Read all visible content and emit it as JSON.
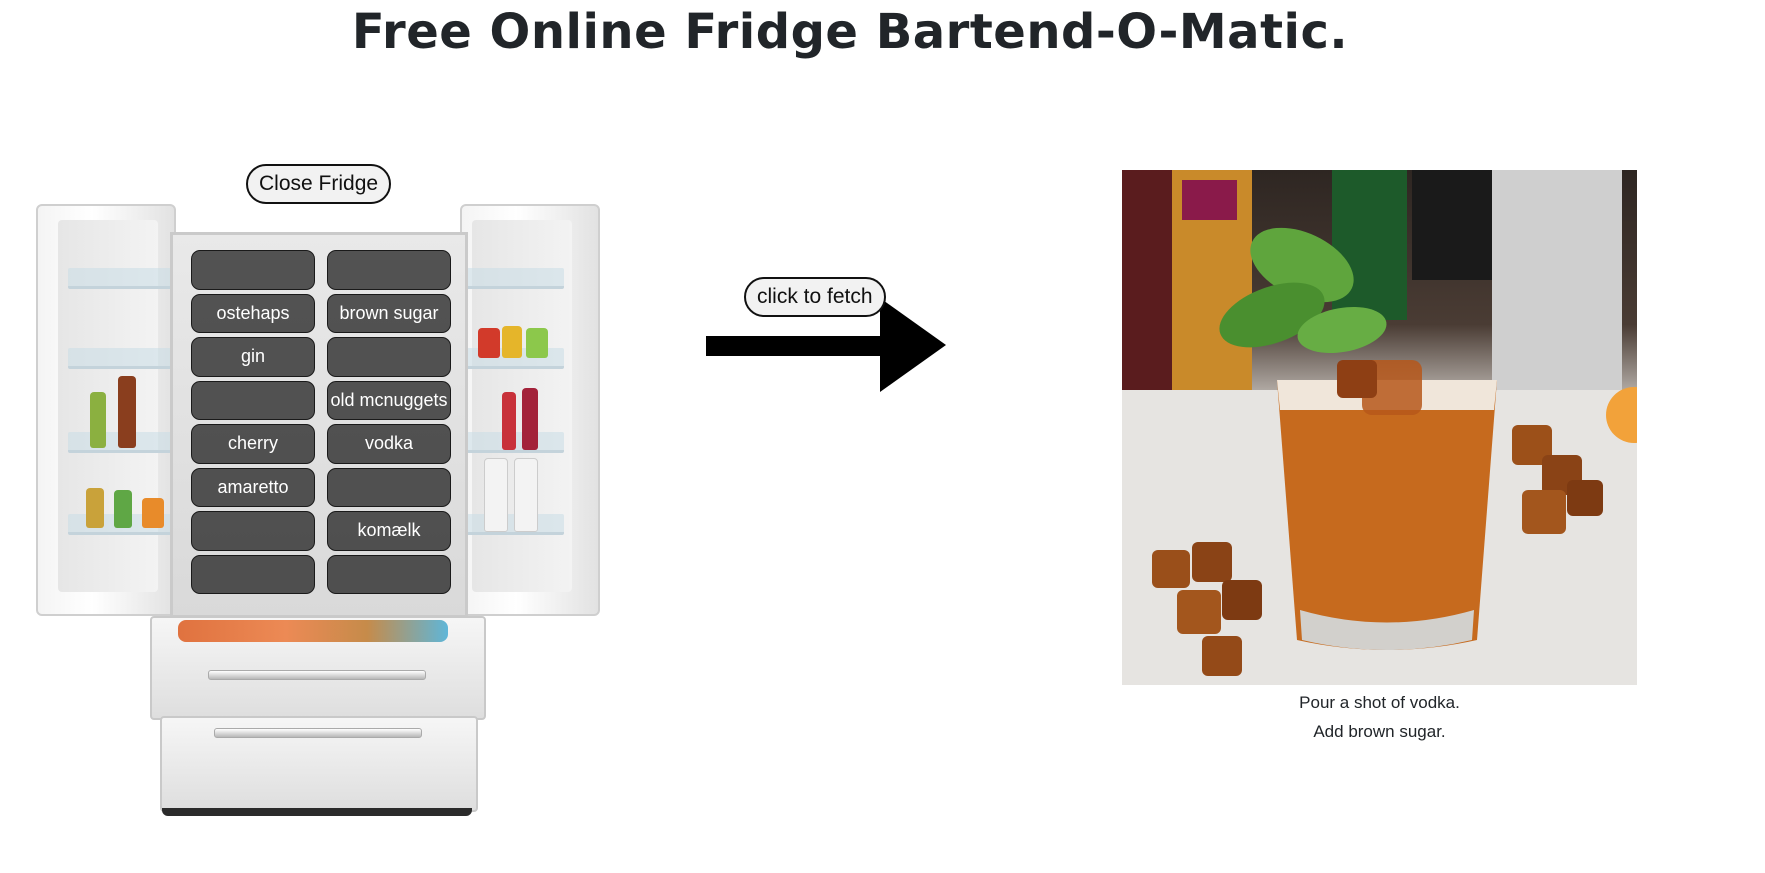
{
  "page": {
    "title": "Free Online Fridge Bartend-O-Matic."
  },
  "fridge": {
    "close_label": "Close Fridge",
    "slots": [
      "",
      "",
      "ostehaps",
      "brown sugar",
      "gin",
      "",
      "",
      "old mcnuggets",
      "cherry",
      "vodka",
      "amaretto",
      "",
      "",
      "komælk",
      "",
      ""
    ]
  },
  "fetch": {
    "label": "click to fetch"
  },
  "recipe": {
    "steps": [
      "Pour a shot of vodka.",
      "Add brown sugar."
    ]
  },
  "colors": {
    "slot_bg": "#2a2a2a",
    "button_bg": "#f2f2f2",
    "arrow": "#000000"
  }
}
